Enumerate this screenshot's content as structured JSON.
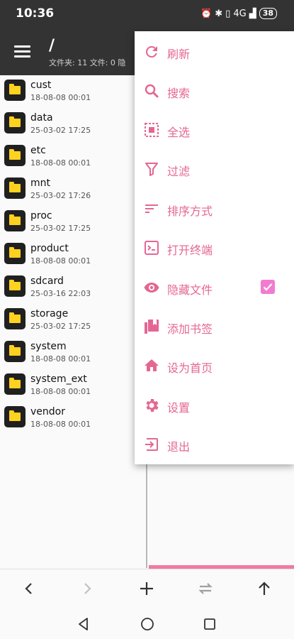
{
  "status": {
    "time": "10:36",
    "signal": "4G",
    "battery": "38"
  },
  "header": {
    "path": "/",
    "subtitle": "文件夹: 11  文件: 0  隐"
  },
  "files": [
    {
      "name": "cust",
      "date": "18-08-08 00:01"
    },
    {
      "name": "data",
      "date": "25-03-02 17:25"
    },
    {
      "name": "etc",
      "date": "18-08-08 00:01"
    },
    {
      "name": "mnt",
      "date": "25-03-02 17:26"
    },
    {
      "name": "proc",
      "date": "25-03-02 17:25"
    },
    {
      "name": "product",
      "date": "18-08-08 00:01"
    },
    {
      "name": "sdcard",
      "date": "25-03-16 22:03"
    },
    {
      "name": "storage",
      "date": "25-03-02 17:25"
    },
    {
      "name": "system",
      "date": "18-08-08 00:01"
    },
    {
      "name": "system_ext",
      "date": "18-08-08 00:01"
    },
    {
      "name": "vendor",
      "date": "18-08-08 00:01"
    }
  ],
  "menu": [
    {
      "label": "刷新",
      "icon": "refresh-icon"
    },
    {
      "label": "搜索",
      "icon": "search-icon"
    },
    {
      "label": "全选",
      "icon": "select-all-icon"
    },
    {
      "label": "过滤",
      "icon": "filter-icon"
    },
    {
      "label": "排序方式",
      "icon": "sort-icon"
    },
    {
      "label": "打开终端",
      "icon": "terminal-icon"
    },
    {
      "label": "隐藏文件",
      "icon": "eye-icon",
      "checked": true
    },
    {
      "label": "添加书签",
      "icon": "bookmark-icon"
    },
    {
      "label": "设为首页",
      "icon": "home-icon"
    },
    {
      "label": "设置",
      "icon": "gear-icon"
    },
    {
      "label": "退出",
      "icon": "exit-icon"
    }
  ],
  "colors": {
    "accent": "#e46793",
    "folder": "#ffd21f",
    "appbar": "#333333"
  }
}
